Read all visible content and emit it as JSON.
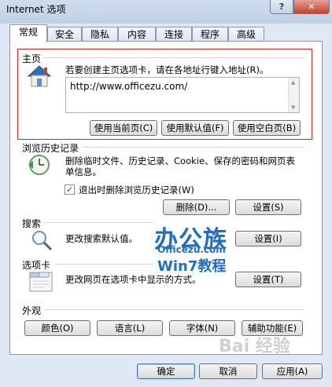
{
  "window": {
    "title": "Internet 选项",
    "help": "?",
    "close": "✕"
  },
  "tabs": [
    "常规",
    "安全",
    "隐私",
    "内容",
    "连接",
    "程序",
    "高级"
  ],
  "homepage": {
    "label": "主页",
    "description": "若要创建主页选项卡，请在各地址行键入地址(R)。",
    "url": "http://www.officezu.com/",
    "buttons": {
      "current": "使用当前页(C)",
      "default": "使用默认值(F)",
      "blank": "使用空白页(B)"
    }
  },
  "history": {
    "label": "浏览历史记录",
    "description": "删除临时文件、历史记录、Cookie、保存的密码和网页表单信息。",
    "checkbox_label": "退出时删除浏览历史记录(W)",
    "checkbox_checked": true,
    "delete_button": "删除(D)...",
    "settings_button": "设置(S)"
  },
  "search": {
    "label": "搜索",
    "description": "更改搜索默认值。",
    "settings_button": "设置(I)"
  },
  "tabs_section": {
    "label": "选项卡",
    "description": "更改网页在选项卡中显示的方式。",
    "settings_button": "设置(T)"
  },
  "appearance": {
    "label": "外观",
    "colors": "颜色(O)",
    "languages": "语言(L)",
    "fonts": "字体(N)",
    "accessibility": "辅助功能(E)"
  },
  "footer": {
    "ok": "确定",
    "cancel": "取消",
    "apply": "应用(A)"
  },
  "watermarks": {
    "brand": "办公族",
    "site": "Officezu.com",
    "tutorial": "Win7教程",
    "baidu": "Bai 经验"
  }
}
